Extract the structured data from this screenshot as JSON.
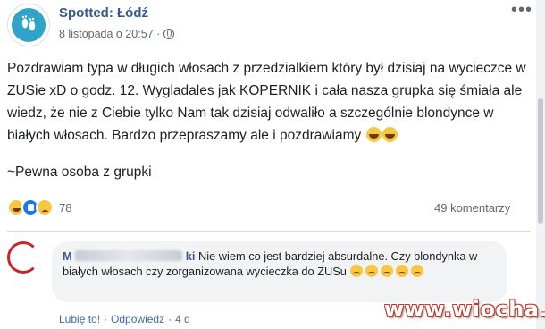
{
  "post": {
    "page_name": "Spotted: Łódź",
    "date": "8 listopada o 20:57 ·",
    "more_icon": "more-dots-icon",
    "globe_icon": "globe-icon",
    "text": "Pozdrawiam typa w długich włosach z przedzialkiem który był dzisiaj na wycieczce w ZUSie xD o godz. 12. Wygladales jak KOPERNIK i cała nasza grupka się śmiała ale wiedz, że nie z Ciebie tylko Nam tak dzisiaj odwaliło a szczególnie blondynce w białych włosach. Bardzo przepraszamy ale i pozdrawiamy",
    "signature": "~Pewna osoba z grupki",
    "reactions_count": "78",
    "comments_count": "49 komentarzy"
  },
  "comment": {
    "author_visible": "M",
    "author_visible_end": "ki",
    "text": " Nie wiem co jest bardziej absurdalne. Czy blondynka w białych włosach czy zorganizowana wycieczka do ZUSu",
    "like_label": "Lubię to!",
    "reply_label": "Odpowiedz",
    "age": "4 d",
    "separator": "·"
  },
  "watermark": {
    "text": "www.wiocha.pl"
  },
  "colors": {
    "link": "#385898",
    "text": "#1c1e21",
    "meta": "#606770",
    "bubble": "#f2f3f5"
  }
}
